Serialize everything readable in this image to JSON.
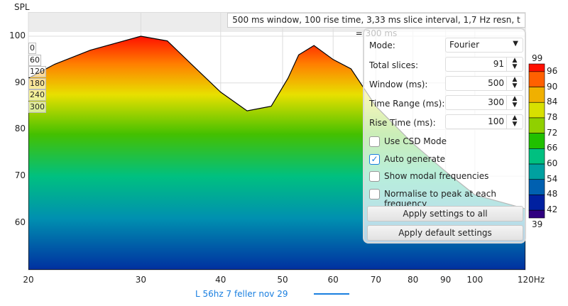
{
  "chart_data": {
    "type": "area",
    "title": "500 ms window, 100 rise time, 3,33 ms slice interval, 1,7 Hz resn, t = 300 ms",
    "ylabel": "SPL",
    "xlabel": "Hz",
    "ylim": [
      50,
      105
    ],
    "xlim": [
      20,
      120
    ],
    "y_ticks": [
      "100",
      "90",
      "80",
      "70",
      "60"
    ],
    "x_ticks": [
      "20",
      "30",
      "40",
      "50",
      "60",
      "70",
      "80",
      "90",
      "100",
      "120Hz"
    ],
    "slice_labels": [
      "0",
      "60",
      "120",
      "180",
      "240",
      "300"
    ],
    "peak_profile": {
      "freq_hz": [
        20,
        22,
        25,
        30,
        33,
        36,
        40,
        44,
        48,
        51,
        53,
        56,
        60,
        64,
        70,
        80,
        90,
        100,
        120
      ],
      "spl_db": [
        91,
        94,
        97,
        100,
        99,
        94,
        88,
        84,
        85,
        91,
        96,
        98,
        95,
        93,
        85,
        77,
        71,
        66,
        63
      ]
    },
    "colorbar": {
      "top": "99",
      "bottom": "39",
      "ticks": [
        "96",
        "90",
        "84",
        "78",
        "72",
        "66",
        "60",
        "54",
        "48",
        "42"
      ]
    },
    "legend": [
      {
        "name": "L 56hz 7 feller nov 29",
        "color": "#1a7fe0"
      }
    ]
  },
  "panel": {
    "mode_label": "Mode:",
    "mode_value": "Fourier",
    "total_slices_label": "Total slices:",
    "total_slices": "91",
    "window_label": "Window (ms):",
    "window": "500",
    "time_range_label": "Time Range (ms):",
    "time_range": "300",
    "rise_time_label": "Rise Time (ms):",
    "rise_time": "100",
    "use_csd": "Use CSD Mode",
    "auto_generate": "Auto generate",
    "show_modal": "Show modal frequencies",
    "normalise": "Normalise to peak at each frequency",
    "apply_all": "Apply settings to all",
    "apply_default": "Apply default settings"
  }
}
